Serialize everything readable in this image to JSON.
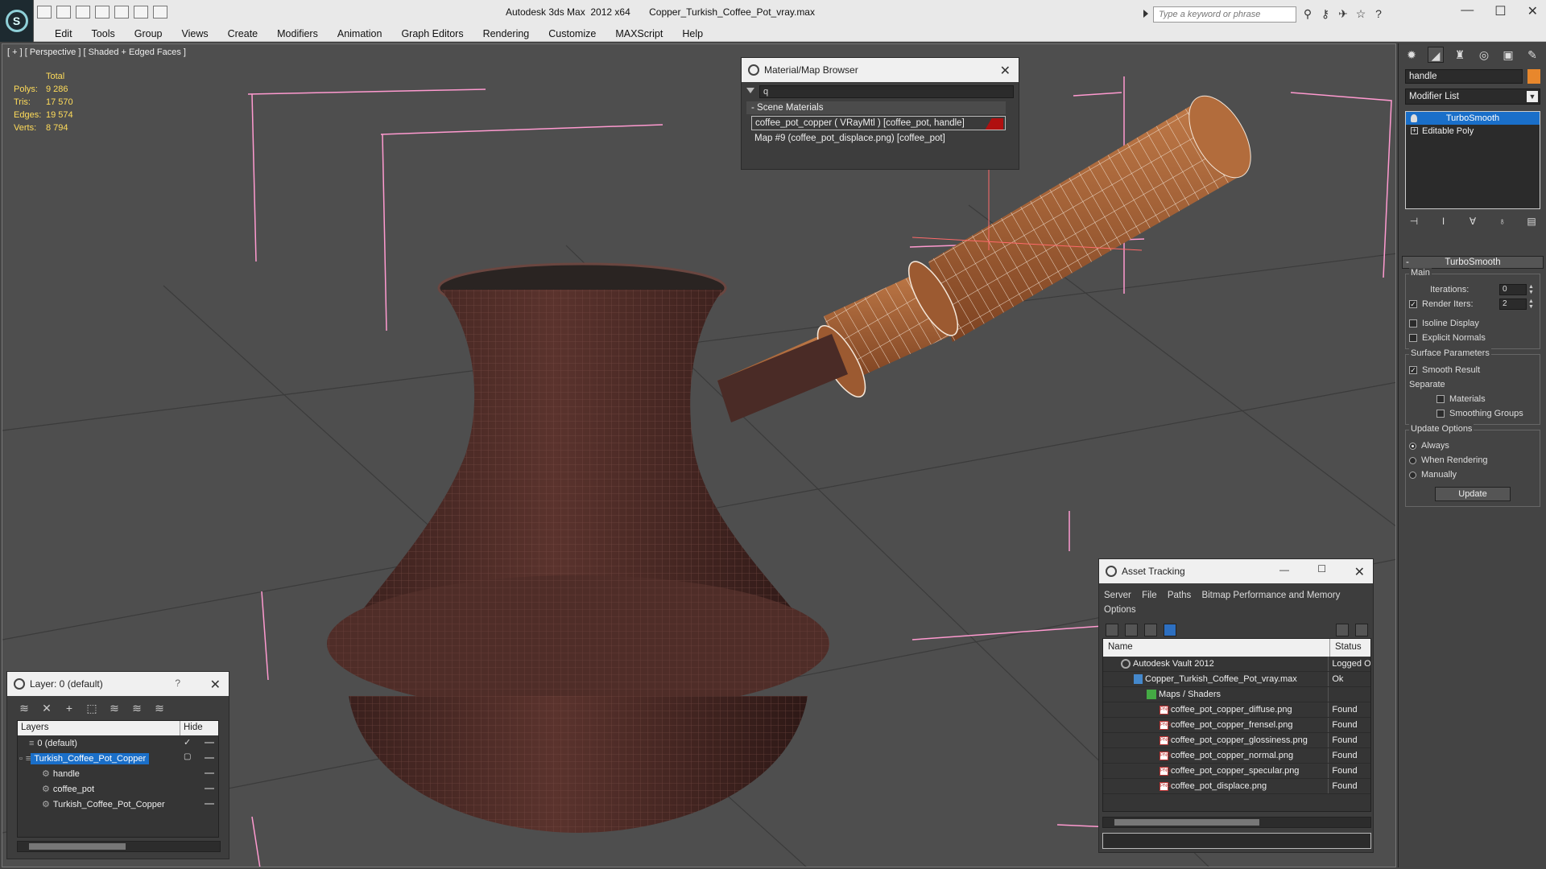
{
  "app": {
    "title": "Autodesk 3ds Max  2012 x64       Copper_Turkish_Coffee_Pot_vray.max",
    "search_placeholder": "Type a keyword or phrase"
  },
  "menu": [
    "Edit",
    "Tools",
    "Group",
    "Views",
    "Create",
    "Modifiers",
    "Animation",
    "Graph Editors",
    "Rendering",
    "Customize",
    "MAXScript",
    "Help"
  ],
  "viewport": {
    "label": "[ + ] [ Perspective ] [ Shaded + Edged Faces ]",
    "stats_header": "Total",
    "stats": [
      {
        "key": "Polys:",
        "value": "9 286"
      },
      {
        "key": "Tris:",
        "value": "17 570"
      },
      {
        "key": "Edges:",
        "value": "19 574"
      },
      {
        "key": "Verts:",
        "value": "8 794"
      }
    ]
  },
  "material_browser": {
    "title": "Material/Map Browser",
    "search_value": "q",
    "section": "Scene Materials",
    "items": [
      "coffee_pot_copper  ( VRayMtl ) [coffee_pot, handle]",
      "Map #9 (coffee_pot_displace.png) [coffee_pot]"
    ]
  },
  "layer_panel": {
    "title": "Layer: 0 (default)",
    "help": "?",
    "col_layers": "Layers",
    "col_hide": "Hide",
    "rows": [
      {
        "name": "0 (default)"
      },
      {
        "name": "Turkish_Coffee_Pot_Copper"
      },
      {
        "name": "handle"
      },
      {
        "name": "coffee_pot"
      },
      {
        "name": "Turkish_Coffee_Pot_Copper"
      }
    ]
  },
  "asset_tracking": {
    "title": "Asset Tracking",
    "menu": [
      "Server",
      "File",
      "Paths",
      "Bitmap Performance and Memory",
      "Options"
    ],
    "col_name": "Name",
    "col_status": "Status",
    "rows": [
      {
        "name": "Autodesk Vault 2012",
        "status": "Logged Out",
        "icon": "vault-icon"
      },
      {
        "name": "Copper_Turkish_Coffee_Pot_vray.max",
        "status": "Ok",
        "icon": "max-file-icon"
      },
      {
        "name": "Maps / Shaders",
        "status": "",
        "icon": "maps-icon"
      },
      {
        "name": "coffee_pot_copper_diffuse.png",
        "status": "Found",
        "icon": "png-icon"
      },
      {
        "name": "coffee_pot_copper_frensel.png",
        "status": "Found",
        "icon": "png-icon"
      },
      {
        "name": "coffee_pot_copper_glossiness.png",
        "status": "Found",
        "icon": "png-icon"
      },
      {
        "name": "coffee_pot_copper_normal.png",
        "status": "Found",
        "icon": "png-icon"
      },
      {
        "name": "coffee_pot_copper_specular.png",
        "status": "Found",
        "icon": "png-icon"
      },
      {
        "name": "coffee_pot_displace.png",
        "status": "Found",
        "icon": "png-icon"
      }
    ]
  },
  "command_panel": {
    "object_name": "handle",
    "object_color": "#e8872c",
    "modifier_list": "Modifier List",
    "stack": [
      "TurboSmooth",
      "Editable Poly"
    ],
    "rollout_title": "TurboSmooth",
    "main_label": "Main",
    "iterations_label": "Iterations:",
    "iterations_value": "0",
    "render_iters_label": "Render Iters:",
    "render_iters_value": "2",
    "isoline_label": "Isoline Display",
    "explicit_normals_label": "Explicit Normals",
    "surface_params_label": "Surface Parameters",
    "smooth_result_label": "Smooth Result",
    "separate_label": "Separate",
    "materials_label": "Materials",
    "smoothing_groups_label": "Smoothing Groups",
    "update_options_label": "Update Options",
    "always_label": "Always",
    "when_rendering_label": "When Rendering",
    "manually_label": "Manually",
    "update_button": "Update"
  },
  "colors": {
    "selection": "#1a6fc9",
    "stats_text": "#ffdc5a",
    "pot_copper": "#4a2b26",
    "handle_wood": "#a45f33"
  }
}
